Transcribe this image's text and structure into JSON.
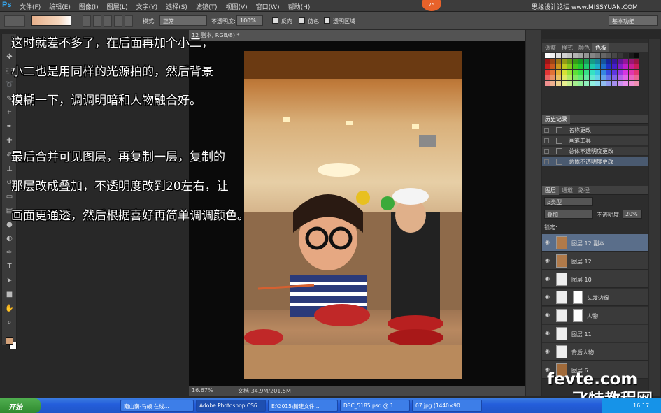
{
  "menubar": {
    "logo": "Ps",
    "items": [
      "文件(F)",
      "编辑(E)",
      "图像(I)",
      "图层(L)",
      "文字(Y)",
      "选择(S)",
      "滤镜(T)",
      "视图(V)",
      "窗口(W)",
      "帮助(H)"
    ],
    "badge": "75",
    "watermark": "思缘设计论坛 www.MISSYUAN.COM"
  },
  "options": {
    "mode_label": "模式:",
    "mode_value": "正常",
    "opacity_label": "不透明度:",
    "opacity_value": "100%",
    "reverse_label": "反向",
    "dither_label": "仿色",
    "transparency_label": "透明区域",
    "workspace": "基本功能"
  },
  "document": {
    "tab_title": "12 副本, RGB/8) *",
    "zoom": "16.67%",
    "doc_size": "文档:34.9M/201.5M"
  },
  "overlay": {
    "line1": "这时就差不多了，在后面再加个小二，",
    "line2": "小二也是用同样的光源拍的，然后背景",
    "line3": "模糊一下，调调明暗和人物融合好。",
    "line4": "最后合并可见图层，再复制一层，复制的",
    "line5": "那层改成叠加，不透明度改到20左右，让",
    "line6": "画面更通透，然后根据喜好再简单调调颜色。"
  },
  "swatches_panel": {
    "tabs": [
      "调整",
      "样式",
      "颜色",
      "色板"
    ]
  },
  "history_panel": {
    "title": "历史记录",
    "items": [
      "名称更改",
      "画笔工具",
      "总体不透明度更改",
      "总体不透明度更改"
    ]
  },
  "layers_panel": {
    "tabs": [
      "图层",
      "通道",
      "路径"
    ],
    "filter": "ρ类型",
    "blend_mode": "叠加",
    "opacity_label": "不透明度:",
    "opacity_value": "20%",
    "lock_label": "锁定:",
    "layers": [
      {
        "name": "图层 12 副本",
        "selected": true
      },
      {
        "name": "图层 12"
      },
      {
        "name": "图层 10"
      },
      {
        "name": "头发边缘"
      },
      {
        "name": "人物"
      },
      {
        "name": "图层 11"
      },
      {
        "name": "背后人物"
      },
      {
        "name": "图层 6"
      }
    ]
  },
  "watermark": {
    "line1": "fevte.com",
    "line2": "飞特教程网"
  },
  "taskbar": {
    "start": "开始",
    "buttons": [
      "南山南-马頔 在线...",
      "Adobe Photoshop CS6",
      "E:\\2015\\新建文件...",
      "DSC_5185.psd @ 1...",
      "07.jpg (1440×90..."
    ],
    "clock": "16:17"
  }
}
